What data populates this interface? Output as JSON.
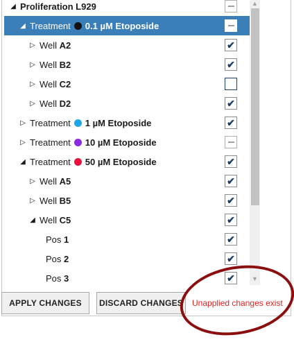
{
  "tree": {
    "rows": [
      {
        "arrow": "◢",
        "prefix": "",
        "name": "Proliferation L929",
        "dot": "",
        "state": "indeterminate",
        "selected": false
      },
      {
        "arrow": "◢",
        "prefix": "Treatment",
        "name": "0.1 µM Etoposide",
        "dot": "#111111",
        "state": "indeterminate",
        "selected": true
      },
      {
        "arrow": "▷",
        "prefix": "Well",
        "name": "A2",
        "dot": "",
        "state": "checked",
        "selected": false
      },
      {
        "arrow": "▷",
        "prefix": "Well",
        "name": "B2",
        "dot": "",
        "state": "checked",
        "selected": false
      },
      {
        "arrow": "▷",
        "prefix": "Well",
        "name": "C2",
        "dot": "",
        "state": "unchecked",
        "selected": false
      },
      {
        "arrow": "▷",
        "prefix": "Well",
        "name": "D2",
        "dot": "",
        "state": "checked",
        "selected": false
      },
      {
        "arrow": "▷",
        "prefix": "Treatment",
        "name": "1 µM Etoposide",
        "dot": "#1ea7e8",
        "state": "checked",
        "selected": false
      },
      {
        "arrow": "▷",
        "prefix": "Treatment",
        "name": "10 µM Etoposide",
        "dot": "#8a2be2",
        "state": "indeterminate",
        "selected": false
      },
      {
        "arrow": "◢",
        "prefix": "Treatment",
        "name": "50 µM Etoposide",
        "dot": "#e8123c",
        "state": "checked",
        "selected": false
      },
      {
        "arrow": "▷",
        "prefix": "Well",
        "name": "A5",
        "dot": "",
        "state": "checked",
        "selected": false
      },
      {
        "arrow": "▷",
        "prefix": "Well",
        "name": "B5",
        "dot": "",
        "state": "checked",
        "selected": false
      },
      {
        "arrow": "◢",
        "prefix": "Well",
        "name": "C5",
        "dot": "",
        "state": "checked",
        "selected": false
      },
      {
        "arrow": "",
        "prefix": "Pos",
        "name": "1",
        "dot": "",
        "state": "checked",
        "selected": false
      },
      {
        "arrow": "",
        "prefix": "Pos",
        "name": "2",
        "dot": "",
        "state": "checked",
        "selected": false
      },
      {
        "arrow": "",
        "prefix": "Pos",
        "name": "3",
        "dot": "",
        "state": "checked",
        "selected": false
      }
    ]
  },
  "buttons": {
    "apply": "APPLY CHANGES",
    "discard": "DISCARD CHANGES"
  },
  "status": "Unapplied changes exist",
  "colors": {
    "selection": "#3a7fb8",
    "status": "#e02020",
    "annotation_ring": "#8c0f0f"
  }
}
